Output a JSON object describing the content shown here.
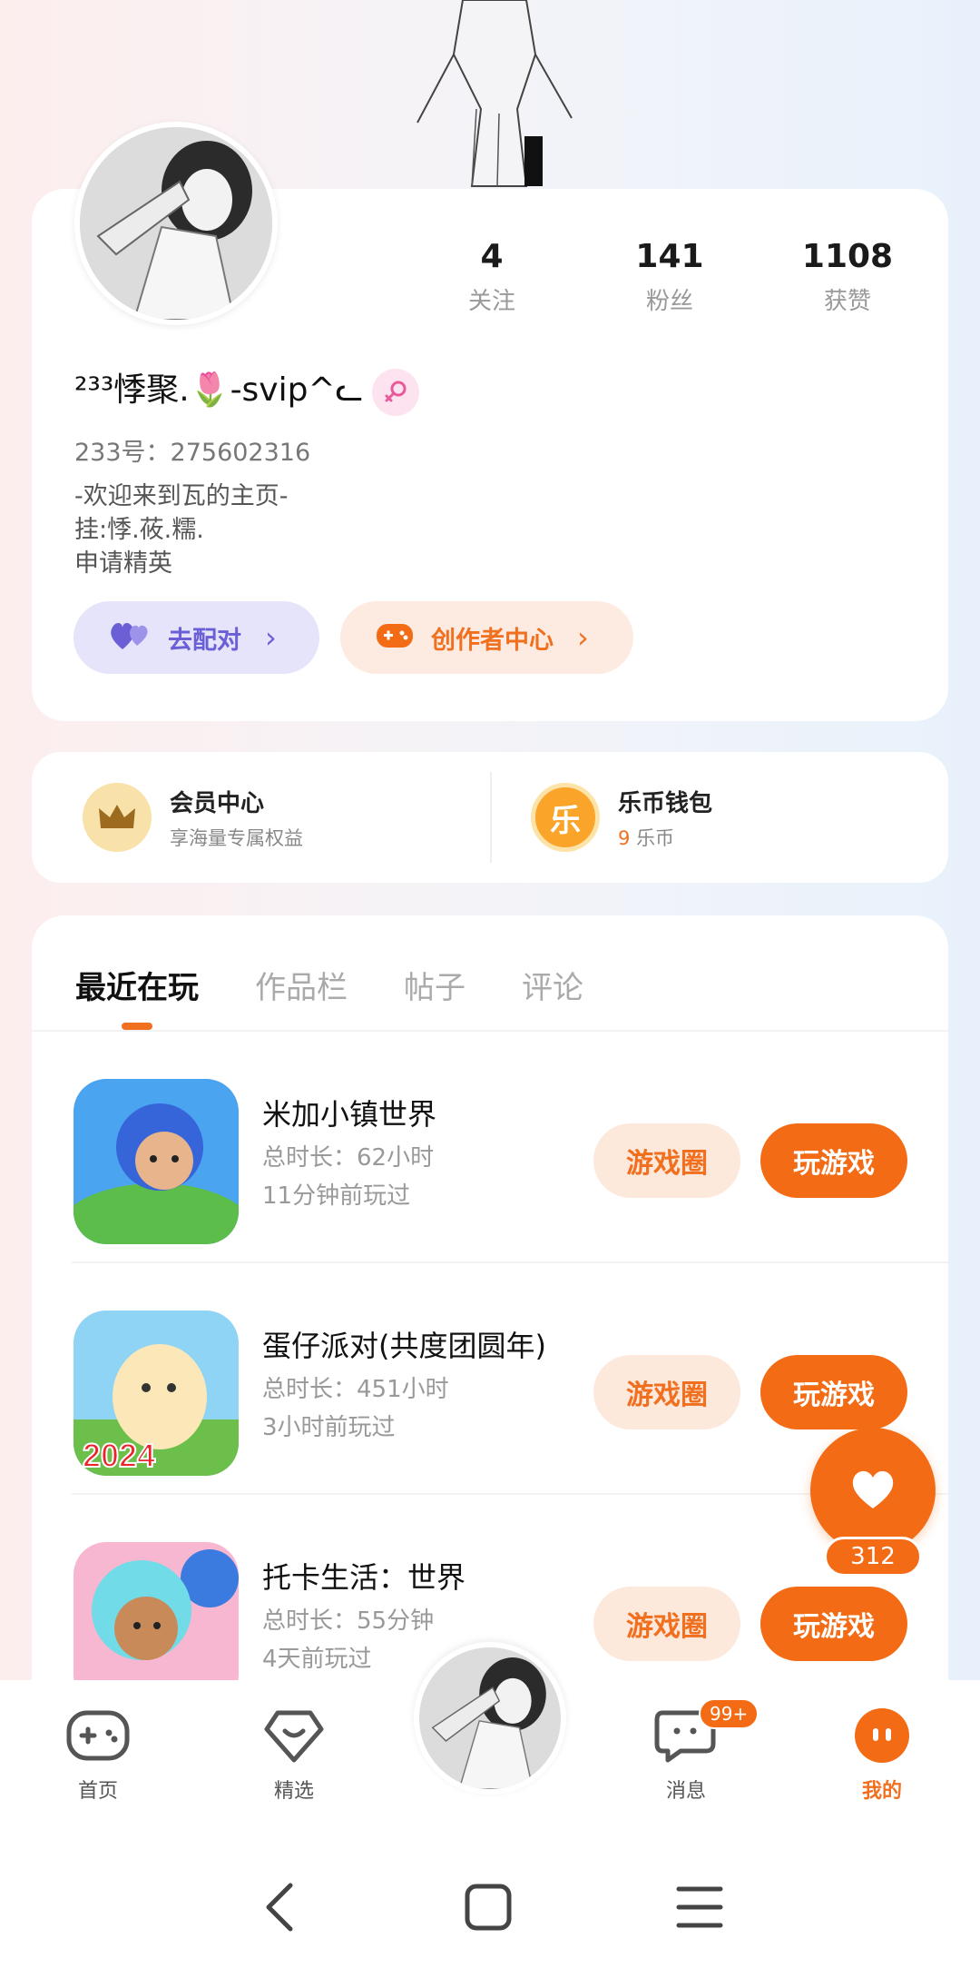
{
  "profile": {
    "stats": [
      {
        "value": "4",
        "label": "关注"
      },
      {
        "value": "141",
        "label": "粉丝"
      },
      {
        "value": "1108",
        "label": "获赞"
      }
    ],
    "username": "²³³悸聚.🌷-svip^ᓚ",
    "uid": "233号：275602316",
    "bio": [
      "-欢迎来到瓦的主页-",
      "挂:悸.莜.糯.",
      "申请精英"
    ],
    "match_label": "去配对",
    "creator_label": "创作者中心"
  },
  "vip": {
    "member_title": "会员中心",
    "member_sub": "享海量专属权益",
    "wallet_title": "乐币钱包",
    "wallet_icon_char": "乐",
    "wallet_amount": "9",
    "wallet_unit": "乐币"
  },
  "tabs": [
    "最近在玩",
    "作品栏",
    "帖子",
    "评论"
  ],
  "games": [
    {
      "name": "米加小镇世界",
      "time": "总时长：62小时",
      "last": "11分钟前玩过",
      "circle": "游戏圈",
      "play": "玩游戏"
    },
    {
      "name": "蛋仔派对(共度团圆年)",
      "time": "总时长：451小时",
      "last": "3小时前玩过",
      "circle": "游戏圈",
      "play": "玩游戏"
    },
    {
      "name": "托卡生活：世界",
      "time": "总时长：55分钟",
      "last": "4天前玩过",
      "circle": "游戏圈",
      "play": "玩游戏"
    }
  ],
  "like_count": "312",
  "nav": {
    "home": "首页",
    "featured": "精选",
    "messages": "消息",
    "messages_badge": "99+",
    "mine": "我的"
  },
  "colors": {
    "accent": "#f36c15",
    "match": "#6b5fd6"
  }
}
